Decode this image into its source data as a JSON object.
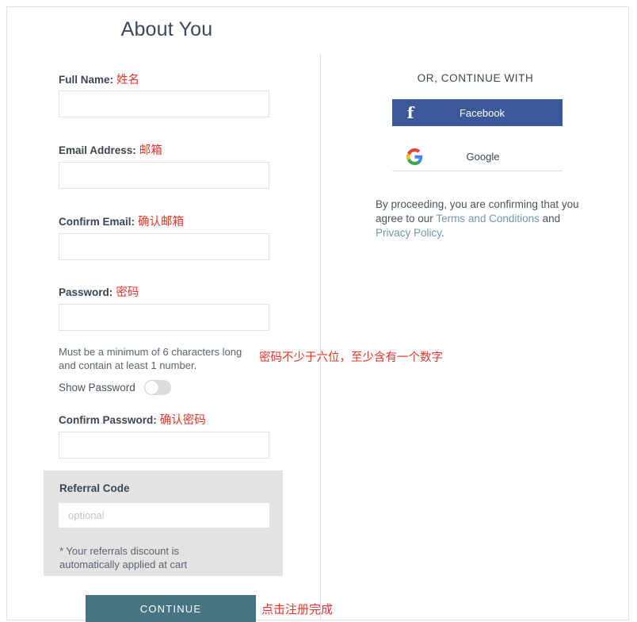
{
  "page": {
    "title": "About You"
  },
  "form": {
    "fields": [
      {
        "label": "Full Name:",
        "annotation": "姓名",
        "value": "",
        "placeholder": "",
        "name": "full-name"
      },
      {
        "label": "Email Address:",
        "annotation": "邮箱",
        "value": "",
        "placeholder": "",
        "name": "email-address"
      },
      {
        "label": "Confirm Email:",
        "annotation": "确认邮箱",
        "value": "",
        "placeholder": "",
        "name": "confirm-email"
      },
      {
        "label": "Password:",
        "annotation": "密码",
        "value": "",
        "placeholder": "",
        "name": "password"
      },
      {
        "label": "Confirm Password:",
        "annotation": "确认密码",
        "value": "",
        "placeholder": "",
        "name": "confirm-password"
      }
    ],
    "password_hint": "Must be a minimum of 6 characters long and contain at least 1 number.",
    "password_hint_annotation": "密码不少于六位，至少含有一个数字",
    "show_password_label": "Show Password",
    "show_password_state": "off",
    "referral": {
      "title": "Referral Code",
      "placeholder": "optional",
      "value": "",
      "note": "* Your referrals discount is automatically applied at cart"
    },
    "continue_label": "CONTINUE",
    "continue_annotation": "点击注册完成"
  },
  "social": {
    "heading": "OR, CONTINUE WITH",
    "facebook_label": "Facebook",
    "facebook_icon": "f",
    "google_label": "Google",
    "legal": {
      "part1": "By proceeding, you are confirming that you agree to our ",
      "terms_link": "Terms and Conditions",
      "part2": " and ",
      "privacy_link": "Privacy Policy",
      "part3": "."
    }
  },
  "colors": {
    "facebook_blue": "#3b5998",
    "continue_teal": "#477482",
    "annotation_red": "#e8342a",
    "link_blue": "#6f9aa8",
    "referral_bg": "#e3e3e3"
  }
}
